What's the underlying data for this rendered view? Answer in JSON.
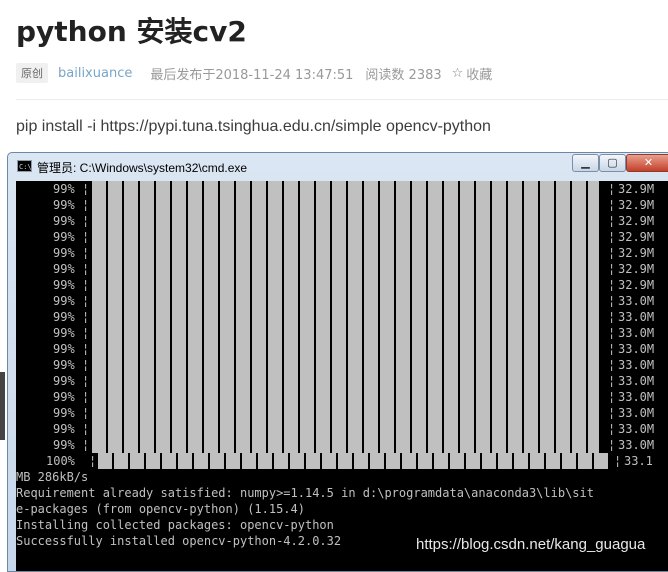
{
  "article": {
    "title": "python 安装cv2",
    "tag": "原创",
    "author": "bailixuance",
    "published": "最后发布于2018-11-24 13:47:51",
    "reads": "阅读数 2383",
    "favorite_label": "收藏",
    "command": "pip install -i https://pypi.tuna.tsinghua.edu.cn/simple opencv-python"
  },
  "window": {
    "title": "管理员: C:\\Windows\\system32\\cmd.exe",
    "icon": "cmd-icon",
    "min_label": "▁",
    "max_label": "▢",
    "close_label": "✕"
  },
  "console": {
    "progress_rows": [
      {
        "percent": "99%",
        "progress": 0.99,
        "size": "32.9M"
      },
      {
        "percent": "99%",
        "progress": 0.99,
        "size": "32.9M"
      },
      {
        "percent": "99%",
        "progress": 0.99,
        "size": "32.9M"
      },
      {
        "percent": "99%",
        "progress": 0.99,
        "size": "32.9M"
      },
      {
        "percent": "99%",
        "progress": 0.99,
        "size": "32.9M"
      },
      {
        "percent": "99%",
        "progress": 0.99,
        "size": "32.9M"
      },
      {
        "percent": "99%",
        "progress": 0.99,
        "size": "32.9M"
      },
      {
        "percent": "99%",
        "progress": 0.99,
        "size": "33.0M"
      },
      {
        "percent": "99%",
        "progress": 0.99,
        "size": "33.0M"
      },
      {
        "percent": "99%",
        "progress": 0.99,
        "size": "33.0M"
      },
      {
        "percent": "99%",
        "progress": 0.99,
        "size": "33.0M"
      },
      {
        "percent": "99%",
        "progress": 0.99,
        "size": "33.0M"
      },
      {
        "percent": "99%",
        "progress": 0.99,
        "size": "33.0M"
      },
      {
        "percent": "99%",
        "progress": 0.99,
        "size": "33.0M"
      },
      {
        "percent": "99%",
        "progress": 0.99,
        "size": "33.0M"
      },
      {
        "percent": "99%",
        "progress": 0.99,
        "size": "33.0M"
      },
      {
        "percent": "99%",
        "progress": 0.99,
        "size": "33.0M"
      },
      {
        "percent": "100%",
        "progress": 1.0,
        "size": "33.1"
      }
    ],
    "output_lines": [
      "MB 286kB/s",
      "Requirement already satisfied: numpy>=1.14.5 in d:\\programdata\\anaconda3\\lib\\sit",
      "e-packages (from opencv-python) (1.15.4)",
      "Installing collected packages: opencv-python",
      "Successfully installed opencv-python-4.2.0.32"
    ]
  },
  "watermark": "https://blog.csdn.net/kang_guagua"
}
